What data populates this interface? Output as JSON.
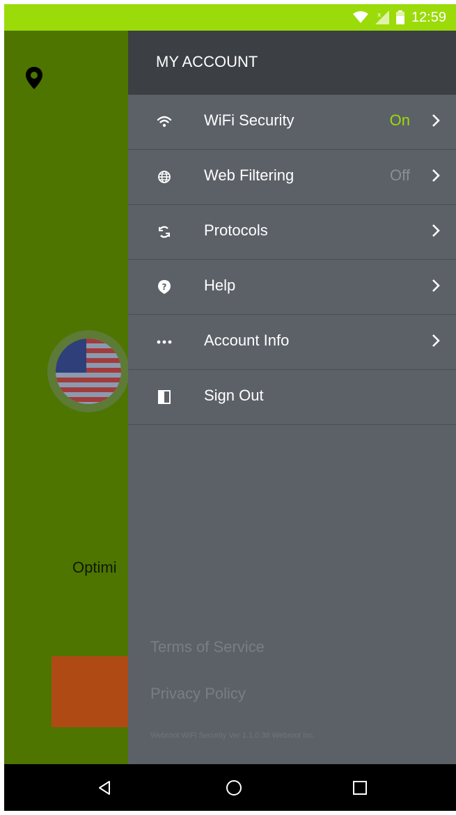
{
  "status_bar": {
    "time": "12:59",
    "color": "#9bdb0a",
    "icons": [
      "wifi-icon",
      "signal-icon",
      "battery-icon"
    ]
  },
  "background": {
    "color": "#4d7500",
    "icons": [
      "location-pin-icon",
      "us-flag-icon"
    ],
    "partial_text": "Optimi",
    "button_color": "#b04a15"
  },
  "drawer": {
    "title": "MY ACCOUNT",
    "items": [
      {
        "icon": "wifi-icon",
        "label": "WiFi Security",
        "status": "On",
        "status_color": "#9bdb0a",
        "chevron": true
      },
      {
        "icon": "globe-icon",
        "label": "Web Filtering",
        "status": "Off",
        "status_color": "#8a8f95",
        "chevron": true
      },
      {
        "icon": "refresh-icon",
        "label": "Protocols",
        "status": "",
        "chevron": true
      },
      {
        "icon": "help-icon",
        "label": "Help",
        "status": "",
        "chevron": true
      },
      {
        "icon": "more-icon",
        "label": "Account Info",
        "status": "",
        "chevron": true
      },
      {
        "icon": "sign-out-icon",
        "label": "Sign Out",
        "status": "",
        "chevron": false
      }
    ],
    "footer": {
      "terms": "Terms of Service",
      "privacy": "Privacy Policy",
      "version": "Webroot WiFi Security Ver 1.1.0.38 Webroot Inc."
    }
  },
  "nav_bar": {
    "buttons": [
      "back-icon",
      "home-icon",
      "recents-icon"
    ]
  }
}
